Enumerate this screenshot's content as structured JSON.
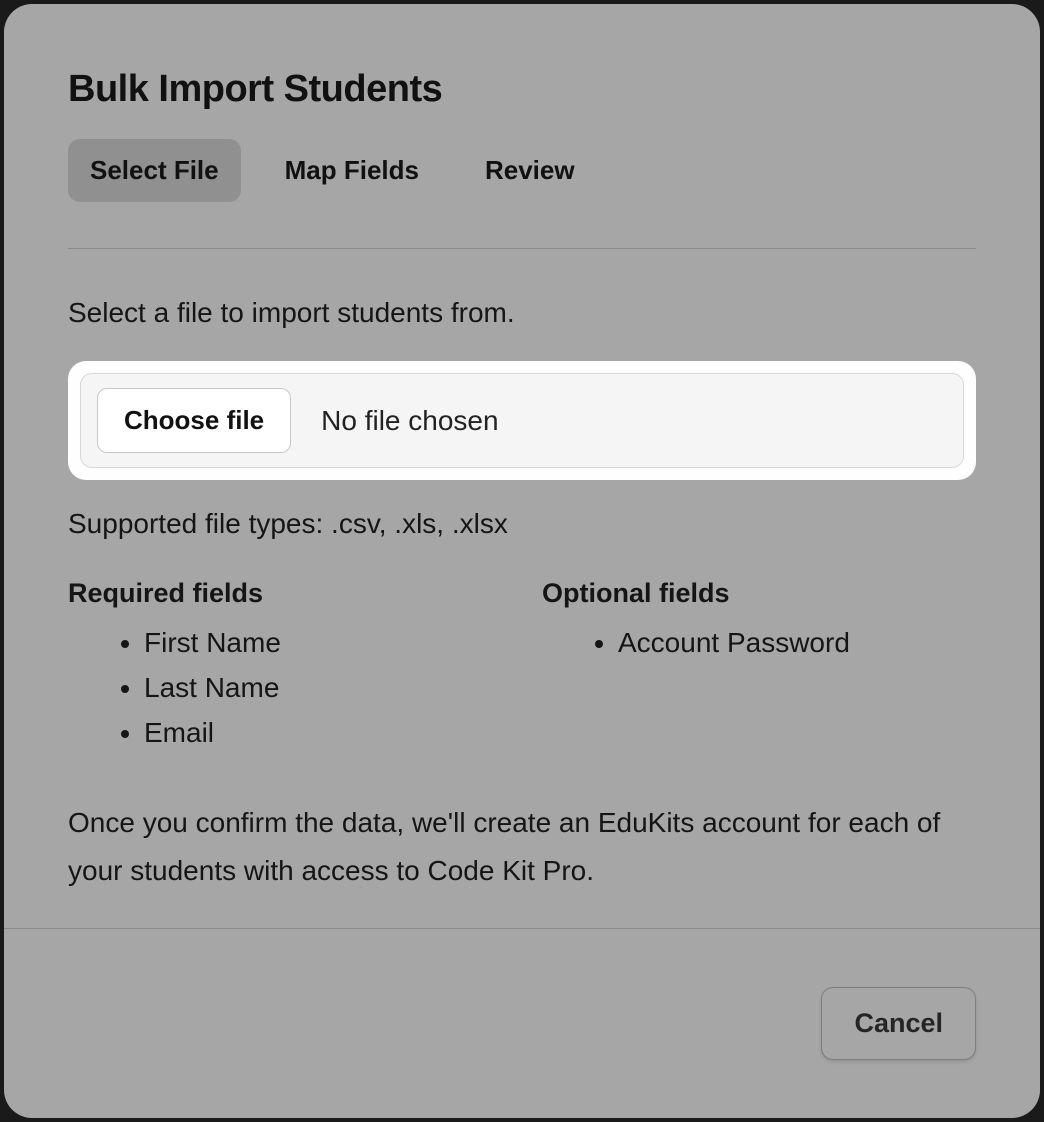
{
  "modal": {
    "title": "Bulk Import Students",
    "tabs": [
      {
        "label": "Select File",
        "active": true
      },
      {
        "label": "Map Fields",
        "active": false
      },
      {
        "label": "Review",
        "active": false
      }
    ]
  },
  "content": {
    "prompt": "Select a file to import students from.",
    "file_picker": {
      "button_label": "Choose file",
      "status": "No file chosen"
    },
    "supported_text": "Supported file types: .csv, .xls, .xlsx",
    "required_fields": {
      "heading": "Required fields",
      "items": [
        "First Name",
        "Last Name",
        "Email"
      ]
    },
    "optional_fields": {
      "heading": "Optional fields",
      "items": [
        "Account Password"
      ]
    },
    "note": "Once you confirm the data, we'll create an EduKits account for each of your students with access to Code Kit Pro."
  },
  "footer": {
    "cancel_label": "Cancel"
  }
}
